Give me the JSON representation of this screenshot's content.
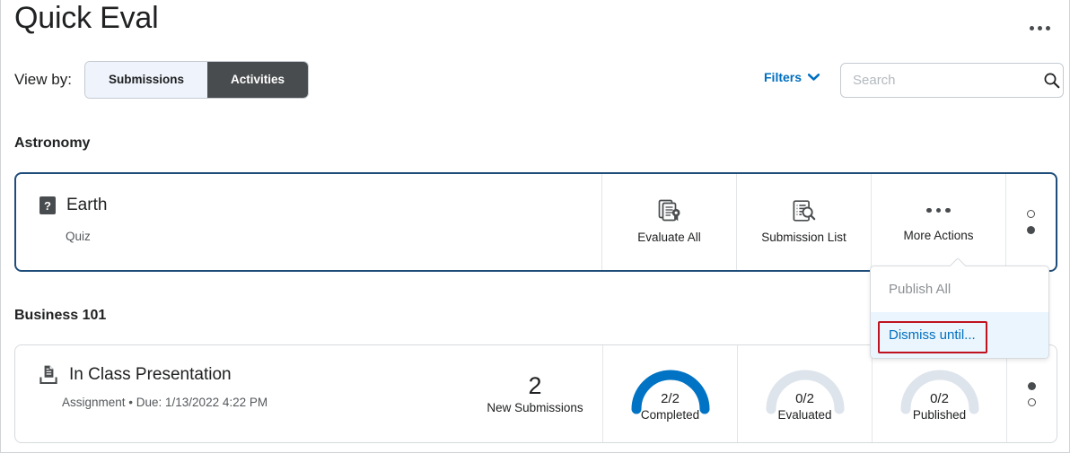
{
  "header": {
    "title": "Quick Eval",
    "overflow_icon": "horizontal-ellipsis-icon"
  },
  "toolbar": {
    "view_by_label": "View by:",
    "segments": [
      {
        "label": "Submissions",
        "selected": false
      },
      {
        "label": "Activities",
        "selected": true
      }
    ],
    "filters_label": "Filters",
    "filters_icon": "chevron-down-icon",
    "search": {
      "placeholder": "Search",
      "value": "",
      "icon": "search-icon"
    }
  },
  "colors": {
    "accent_blue": "#006fbf",
    "gauge_blue": "#0073c4",
    "gauge_track": "#dde4ec",
    "selected_card_border": "#1f4d7a",
    "highlight_red": "#c0111f",
    "segment_active_bg": "#494c4e",
    "segment_inactive_bg": "#eff3fb"
  },
  "courses": [
    {
      "name": "Astronomy",
      "activity": {
        "icon": "quiz-icon",
        "icon_glyph": "?",
        "title": "Earth",
        "subtitle": "Quiz",
        "actions": [
          {
            "label": "Evaluate All",
            "icon": "evaluate-all-icon"
          },
          {
            "label": "Submission List",
            "icon": "submission-list-icon"
          },
          {
            "label": "More Actions",
            "icon": "horizontal-ellipsis-icon"
          }
        ],
        "row_menu_icon": "vertical-ellipsis-icon"
      }
    },
    {
      "name": "Business 101",
      "activity": {
        "icon": "assignment-icon",
        "title": "In Class Presentation",
        "subtitle": "Assignment • Due: 1/13/2022 4:22 PM",
        "stats": [
          {
            "kind": "count",
            "value": "2",
            "label": "New Submissions"
          },
          {
            "kind": "gauge",
            "value": "2/2",
            "label": "Completed",
            "fraction": 1.0,
            "filled": true
          },
          {
            "kind": "gauge",
            "value": "0/2",
            "label": "Evaluated",
            "fraction": 0.0,
            "filled": false
          },
          {
            "kind": "gauge",
            "value": "0/2",
            "label": "Published",
            "fraction": 0.0,
            "filled": false
          }
        ],
        "row_menu_icon": "vertical-ellipsis-icon"
      }
    }
  ],
  "dropdown": {
    "open": true,
    "items": [
      {
        "label": "Publish All",
        "disabled": true,
        "highlighted": false
      },
      {
        "label": "Dismiss until...",
        "disabled": false,
        "highlighted": true
      }
    ]
  }
}
